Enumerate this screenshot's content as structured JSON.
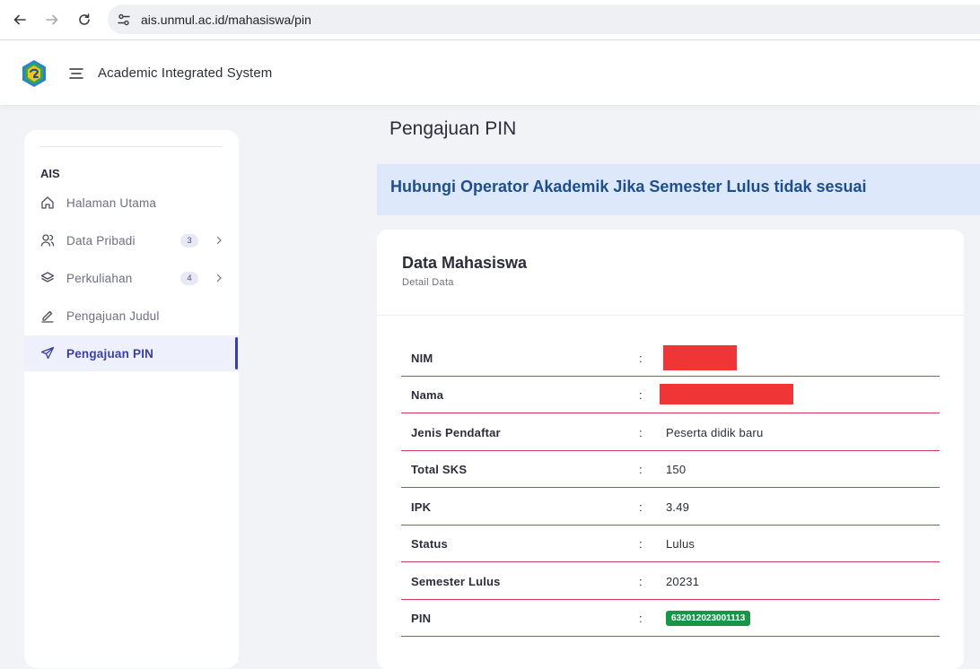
{
  "browser": {
    "url": "ais.unmul.ac.id/mahasiswa/pin"
  },
  "header": {
    "title": "Academic Integrated System"
  },
  "sidebar": {
    "section": "AIS",
    "items": [
      {
        "label": "Halaman Utama",
        "icon": "home-icon"
      },
      {
        "label": "Data Pribadi",
        "icon": "user-icon",
        "badge": "3"
      },
      {
        "label": "Perkuliahan",
        "icon": "layers-icon",
        "badge": "4"
      },
      {
        "label": "Pengajuan Judul",
        "icon": "pencil-icon"
      },
      {
        "label": "Pengajuan PIN",
        "icon": "send-icon",
        "active": true
      }
    ]
  },
  "main": {
    "title": "Pengajuan PIN",
    "alert": "Hubungi Operator Akademik Jika Semester Lulus tidak sesuai",
    "card": {
      "title": "Data Mahasiswa",
      "subtitle": "Detail Data",
      "separator": ":",
      "rows": [
        {
          "key": "NIM",
          "value": "",
          "redacted": true
        },
        {
          "key": "Nama",
          "value": "",
          "redacted": true
        },
        {
          "key": "Jenis Pendaftar",
          "value": "Peserta didik baru"
        },
        {
          "key": "Total SKS",
          "value": "150"
        },
        {
          "key": "IPK",
          "value": "3.49"
        },
        {
          "key": "Status",
          "value": "Lulus"
        },
        {
          "key": "Semester Lulus",
          "value": "20231"
        },
        {
          "key": "PIN",
          "value": "632012023001113",
          "badge": true
        }
      ]
    }
  },
  "colors": {
    "accent": "#3a3fa0",
    "alert_bg": "#dde8fb",
    "alert_text": "#1e4e8c",
    "row_border": "#d23d57",
    "redact": "#f03536",
    "pin_badge": "#17964a"
  }
}
